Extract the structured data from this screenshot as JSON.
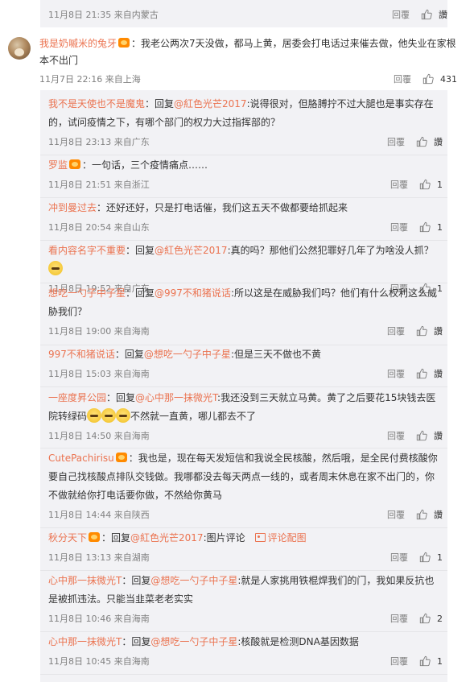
{
  "top_partial": {
    "meta": "11月8日 21:35 来自内蒙古",
    "reply": "回覆",
    "like": "讚"
  },
  "main": {
    "user": "我是奶嘁米的兔牙",
    "text": "：我老公两次7天没做，都马上黄，居委会打电话过来催去做，他失业在家根本不出门",
    "meta": "11月7日 22:16 来自上海",
    "reply": "回覆",
    "like_count": "431"
  },
  "replies": [
    {
      "user": "我不是天使也不是魔鬼",
      "pre": "：回复",
      "at": "@紅色光芒2017",
      "text": ":说得很对，但胳膊拧不过大腿也是事实存在的，试问疫情之下，有哪个部门的权力大过指挥部的？",
      "meta": "11月8日 23:13 来自广东",
      "reply": "回覆",
      "like": "讚"
    },
    {
      "user": "罗监",
      "pre": "",
      "at": "",
      "text": "：一句话，三个疫情痛点……",
      "meta": "11月8日 21:51 来自浙江",
      "reply": "回覆",
      "like": "1"
    },
    {
      "user": "冲到曼过去",
      "pre": "",
      "at": "",
      "text": "：还好还好，只是打电话催，我们这五天不做都要给抓起来",
      "meta": "11月8日 20:54 来自山东",
      "reply": "回覆",
      "like": "1"
    },
    {
      "user": "看内容名字不重要",
      "pre": "：回复",
      "at": "@紅色光芒2017",
      "text": ":真的吗？那他们公然犯罪好几年了为啥没人抓？",
      "meta": "11月8日 19:52 来自广东",
      "reply": "回覆",
      "like": "1"
    },
    {
      "user": "想吃一勺子中子星",
      "pre": "：回复",
      "at": "@997不和猪说话",
      "text": ":所以这是在威胁我们吗？他们有什么权利这么威胁我们？",
      "meta": "11月8日 19:00 来自海南",
      "reply": "回覆",
      "like": "讚"
    },
    {
      "user": "997不和猪说话",
      "pre": "：回复",
      "at": "@想吃一勺子中子星",
      "text": ":但是三天不做也不黄",
      "meta": "11月8日 15:03 来自海南",
      "reply": "回覆",
      "like": "讚"
    },
    {
      "user": "一座度昇公园",
      "pre": "：回复",
      "at": "@心中那一抹微光T",
      "text": ":我还没到三天就立马黄。黄了之后要花15块钱去医院转绿码",
      "text2": "不然就一直黄，哪儿都去不了",
      "meta": "11月8日 14:50 来自海南",
      "reply": "回覆",
      "like": "讚"
    },
    {
      "user": "CutePachirisu",
      "pre": "",
      "at": "",
      "text": "：我也是，现在每天发短信和我说全民核酸，然后哦，是全民付费核酸你要自己找核酸点排队交钱做。我哪都没去每天两点一线的，或者周末休息在家不出门的，你不做就给你打电话要你做，不然给你黄马",
      "meta": "11月8日 14:44 来自陕西",
      "reply": "回覆",
      "like": "讚"
    },
    {
      "user": "秋分天下",
      "pre": "：回复",
      "at": "@紅色光芒2017",
      "text": ":图片评论",
      "pic_link": "评论配图",
      "meta": "11月8日 13:13 来自湖南",
      "reply": "回覆",
      "like": "1"
    },
    {
      "user": "心中那一抹微光T",
      "pre": "：回复",
      "at": "@想吃一勺子中子星",
      "text": ":就是人家挑用铁棍焊我们的门，我如果反抗也是被抓违法。只能当韭菜老老实实",
      "meta": "11月8日 10:46 来自海南",
      "reply": "回覆",
      "like": "2"
    },
    {
      "user": "心中那一抹微光T",
      "pre": "：回复",
      "at": "@想吃一勺子中子星",
      "text": ":核酸就是检测DNA基因数据",
      "meta": "11月8日 10:45 来自海南",
      "reply": "回覆",
      "like": "1"
    }
  ]
}
